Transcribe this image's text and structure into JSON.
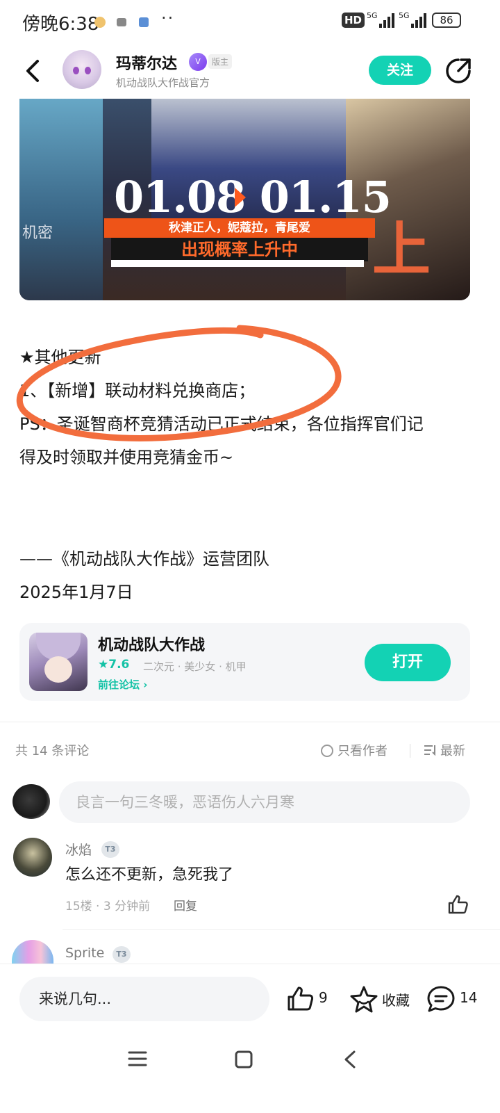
{
  "status_bar": {
    "time": "傍晚6:38",
    "more_dots": "··",
    "hd_label": "HD",
    "net1": "5G",
    "net2": "5G",
    "battery": "86"
  },
  "header": {
    "host_name": "玛蒂尔达",
    "host_badge": "V",
    "host_role": "版主",
    "host_subtitle": "机动战队大作战官方",
    "follow_label": "关注"
  },
  "banner": {
    "secret_tag": "机密",
    "date_text": "01.08  01.15",
    "names_text": "秋津正人，妮蔻拉，青尾爱",
    "rate_text": "出现概率上升中",
    "big_text": "上升!",
    "accent": "#ee5418"
  },
  "article": {
    "lines": [
      "★其他更新",
      "1、【新增】联动材料兑换商店；",
      "PS：圣诞智商杯竞猜活动已正式结束，各位指挥官们记",
      "得及时领取并使用竞猜金币~"
    ],
    "signature": "——《机动战队大作战》运营团队",
    "date": "2025年1月7日",
    "annotation_color": "#f26d3d"
  },
  "game_card": {
    "name": "机动战队大作战",
    "score": "★7.6",
    "tags": "二次元 · 美少女 · 机甲",
    "forum_link": "前往论坛 ›",
    "open_label": "打开",
    "accent": "#13d2b4"
  },
  "comments": {
    "count_label": "共 14 条评论",
    "only_author_label": "只看作者",
    "sort_label": "最新",
    "input_placeholder": "良言一句三冬暖，恶语伤人六月寒",
    "items": [
      {
        "user": "冰焰",
        "level": "T3",
        "text": "怎么还不更新，急死我了",
        "meta": "15楼 · 3 分钟前",
        "reply_label": "回复"
      },
      {
        "user": "Sprite",
        "level": "T3"
      }
    ]
  },
  "bottom_bar": {
    "say_placeholder": "来说几句...",
    "like_count": "9",
    "favorite_label": "收藏",
    "comment_count": "14"
  },
  "icons": {
    "back": "back-arrow-icon",
    "share": "share-icon",
    "like": "thumb-up-icon",
    "favorite": "star-icon",
    "comment": "chat-bubble-icon",
    "nav_menu": "menu-icon",
    "nav_home": "home-square-icon",
    "nav_back": "nav-back-icon"
  }
}
